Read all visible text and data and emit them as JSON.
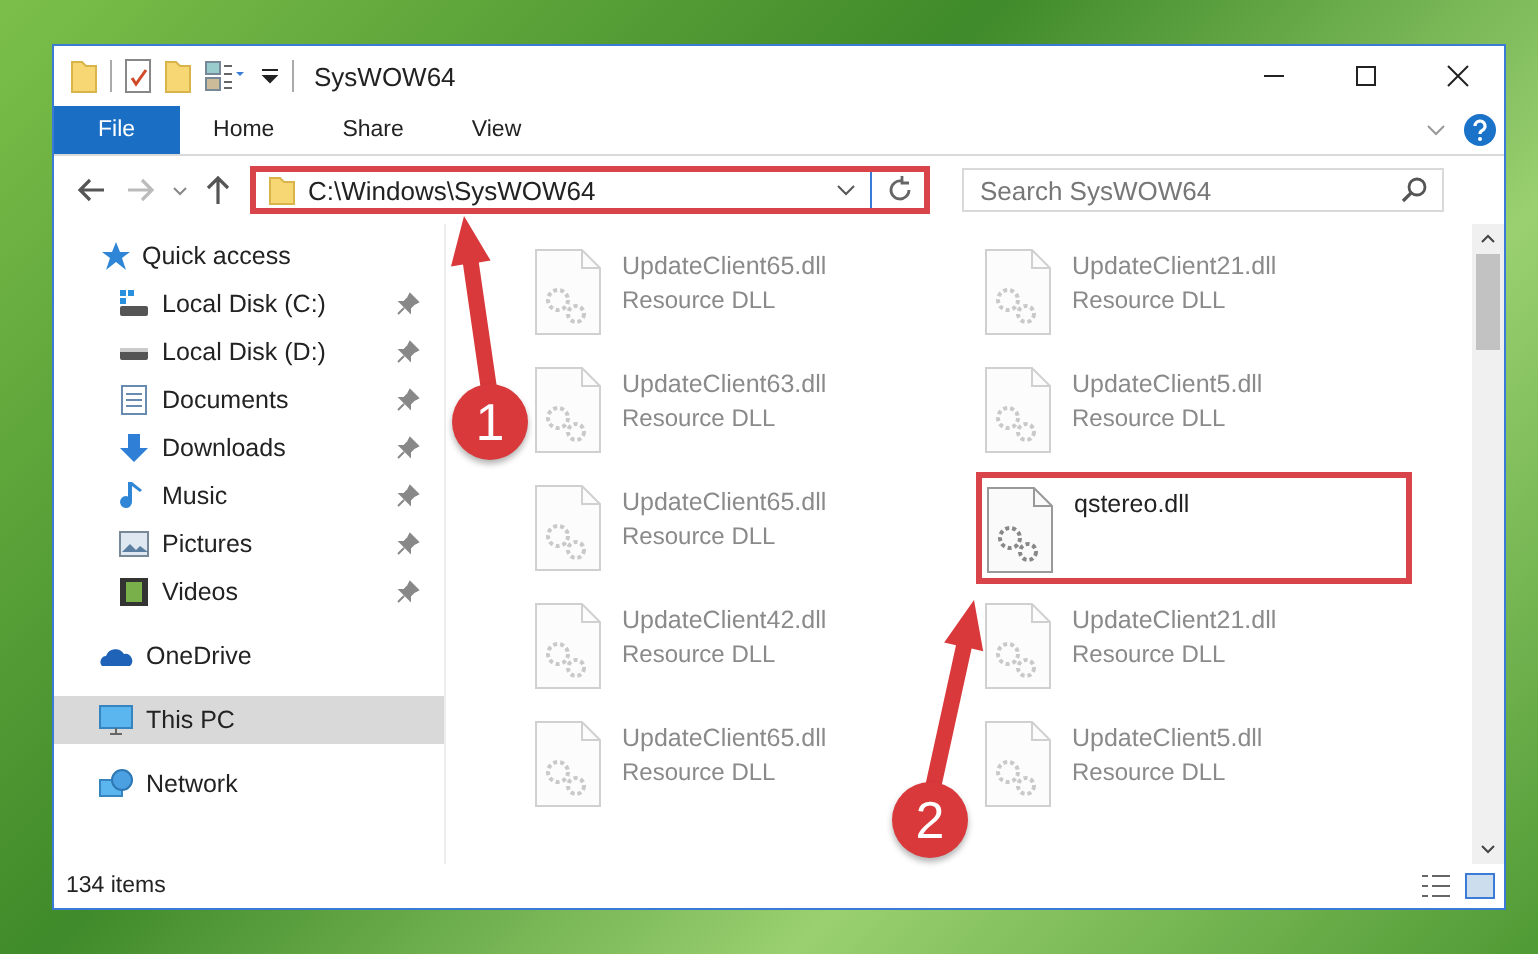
{
  "window": {
    "title": "SysWOW64"
  },
  "ribbon_tabs": [
    {
      "label": "File",
      "selected": true
    },
    {
      "label": "Home",
      "selected": false
    },
    {
      "label": "Share",
      "selected": false
    },
    {
      "label": "View",
      "selected": false
    }
  ],
  "address": {
    "path": "C:\\Windows\\SysWOW64",
    "highlighted": true
  },
  "search": {
    "placeholder": "Search SysWOW64"
  },
  "sidebar": {
    "items": [
      {
        "label": "Quick access",
        "kind": "star",
        "selected": false,
        "children": [
          {
            "label": "Local Disk (C:)",
            "kind": "disk-system",
            "selected": false,
            "pinned": true
          },
          {
            "label": "Local Disk (D:)",
            "kind": "disk",
            "selected": false,
            "pinned": true
          },
          {
            "label": "Documents",
            "kind": "document",
            "selected": false,
            "pinned": true
          },
          {
            "label": "Downloads",
            "kind": "download",
            "selected": false,
            "pinned": true
          },
          {
            "label": "Music",
            "kind": "music",
            "selected": false,
            "pinned": true
          },
          {
            "label": "Pictures",
            "kind": "picture",
            "selected": false,
            "pinned": true
          },
          {
            "label": "Videos",
            "kind": "video",
            "selected": false,
            "pinned": true
          }
        ]
      },
      {
        "label": "OneDrive",
        "kind": "cloud",
        "selected": false
      },
      {
        "label": "This PC",
        "kind": "computer",
        "selected": true
      },
      {
        "label": "Network",
        "kind": "network",
        "selected": false
      }
    ]
  },
  "files": [
    {
      "name": "UpdateClient65.dll",
      "type": "Resource DLL",
      "blurred": true,
      "highlighted": false
    },
    {
      "name": "UpdateClient21.dll",
      "type": "Resource DLL",
      "blurred": true,
      "highlighted": false
    },
    {
      "name": "UpdateClient63.dll",
      "type": "Resource DLL",
      "blurred": true,
      "highlighted": false
    },
    {
      "name": "UpdateClient5.dll",
      "type": "Resource DLL",
      "blurred": true,
      "highlighted": false
    },
    {
      "name": "UpdateClient65.dll",
      "type": "Resource DLL",
      "blurred": true,
      "highlighted": false
    },
    {
      "name": "qstereo.dll",
      "blurred": false,
      "highlighted": true
    },
    {
      "name": "UpdateClient42.dll",
      "type": "Resource DLL",
      "blurred": true,
      "highlighted": false
    },
    {
      "name": "UpdateClient21.dll",
      "type": "Resource DLL",
      "blurred": true,
      "highlighted": false
    },
    {
      "name": "UpdateClient65.dll",
      "type": "Resource DLL",
      "blurred": true,
      "highlighted": false
    },
    {
      "name": "UpdateClient5.dll",
      "type": "Resource DLL",
      "blurred": true,
      "highlighted": false
    }
  ],
  "status_bar": {
    "item_count": "134 items"
  },
  "annotations": [
    {
      "number": "1"
    },
    {
      "number": "2"
    }
  ]
}
